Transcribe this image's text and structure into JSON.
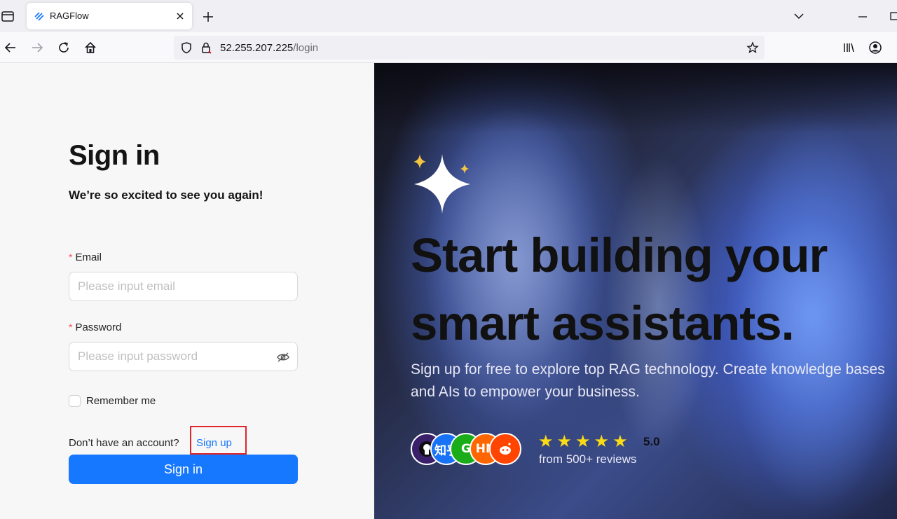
{
  "browser": {
    "tab": {
      "title": "RAGFlow"
    },
    "url": {
      "host": "52.255.207.225",
      "path": "/login"
    }
  },
  "login": {
    "title": "Sign in",
    "subtitle": "We’re so excited to see you again!",
    "email": {
      "label": "Email",
      "required_mark": "*",
      "placeholder": "Please input email",
      "value": ""
    },
    "password": {
      "label": "Password",
      "required_mark": "*",
      "placeholder": "Please input password",
      "value": ""
    },
    "remember_label": "Remember me",
    "remember_checked": false,
    "no_account_text": "Don’t have an account?",
    "signup_link": "Sign up",
    "signin_button": "Sign in"
  },
  "hero": {
    "headline": "Start building your smart assistants.",
    "description": "Sign up for free to explore top RAG technology. Create knowledge bases and AIs to empower your business.",
    "rating": "5.0",
    "stars": "★★★★★",
    "reviews": "from 500+ reviews",
    "avatars": [
      {
        "icon": "github-icon",
        "text": "",
        "color": "#3a1f6b"
      },
      {
        "icon": "zhihu-icon",
        "text": "知乎",
        "color": "#1772f6"
      },
      {
        "icon": "wechat-icon",
        "text": "G",
        "color": "#1aad19"
      },
      {
        "icon": "hackernews-icon",
        "text": "HN",
        "color": "#ff6600"
      },
      {
        "icon": "reddit-icon",
        "text": "",
        "color": "#ff4500"
      }
    ]
  },
  "colors": {
    "primary": "#1677ff",
    "required": "#ff4d4f",
    "highlight_box": "#e0242b"
  }
}
